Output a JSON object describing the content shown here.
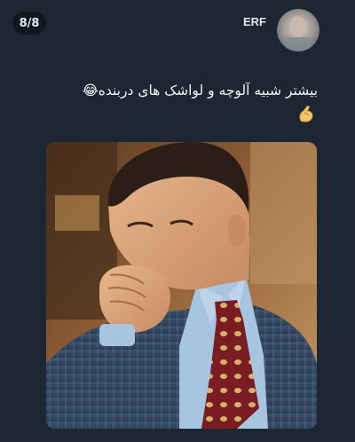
{
  "post": {
    "counter": "8/8",
    "author": "ERF",
    "text": "بیشتر شبیه آلوچه و لواشک های دربنده😂"
  },
  "icons": {
    "avatar": "avatar-photo-blurred",
    "pinch": "pinching-hand-emoji"
  },
  "colors": {
    "background": "#1c2733",
    "text": "#f2f5f7",
    "badge": "#0f171f"
  },
  "image": {
    "description_hint": "meme-photo"
  }
}
